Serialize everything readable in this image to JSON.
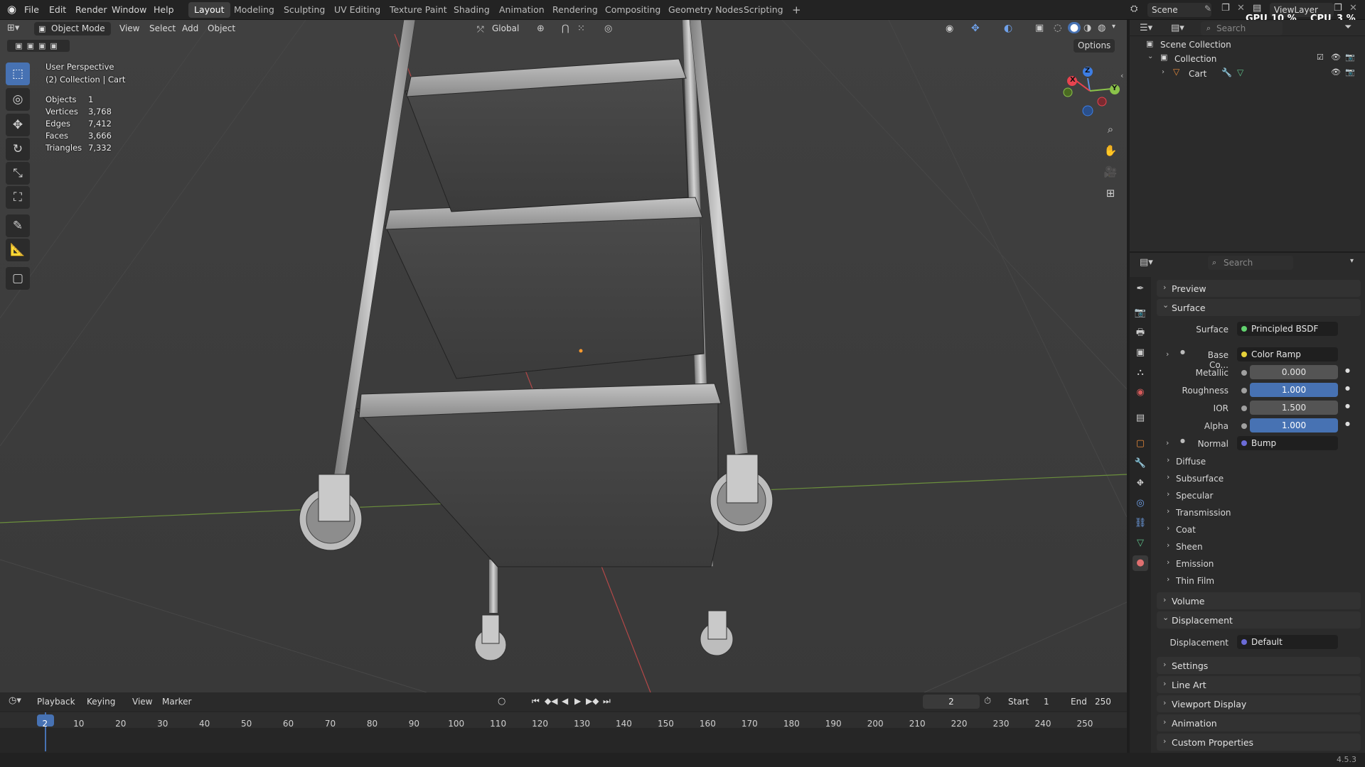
{
  "topbar": {
    "menus": [
      "File",
      "Edit",
      "Render",
      "Window",
      "Help"
    ],
    "workspaces": [
      "Layout",
      "Modeling",
      "Sculpting",
      "UV Editing",
      "Texture Paint",
      "Shading",
      "Animation",
      "Rendering",
      "Compositing",
      "Geometry Nodes",
      "Scripting"
    ],
    "active_workspace": "Layout",
    "add_workspace": "+",
    "scene_label": "Scene",
    "viewlayer_label": "ViewLayer",
    "gpu_label": "GPU",
    "gpu_value": "10 %",
    "cpu_label": "CPU",
    "cpu_value": "3 %"
  },
  "viewport_header": {
    "mode": "Object Mode",
    "menus": [
      "View",
      "Select",
      "Add",
      "Object"
    ],
    "transform_orientation": "Global",
    "options_label": "Options"
  },
  "viewport_overlay": {
    "perspective": "User Perspective",
    "collection_object": "(2) Collection | Cart",
    "stats": [
      {
        "label": "Objects",
        "value": "1"
      },
      {
        "label": "Vertices",
        "value": "3,768"
      },
      {
        "label": "Edges",
        "value": "7,412"
      },
      {
        "label": "Faces",
        "value": "3,666"
      },
      {
        "label": "Triangles",
        "value": "7,332"
      }
    ],
    "gizmo_axes": {
      "x": "X",
      "y": "Y",
      "z": "Z"
    }
  },
  "timeline": {
    "menus": [
      "Playback",
      "Keying",
      "View",
      "Marker"
    ],
    "current_frame": "2",
    "start_label": "Start",
    "start_value": "1",
    "end_label": "End",
    "end_value": "250",
    "ruler": [
      "2",
      "10",
      "20",
      "30",
      "40",
      "50",
      "60",
      "70",
      "80",
      "90",
      "100",
      "110",
      "120",
      "130",
      "140",
      "150",
      "160",
      "170",
      "180",
      "190",
      "200",
      "210",
      "220",
      "230",
      "240",
      "250"
    ]
  },
  "outliner": {
    "search_placeholder": "Search",
    "scene_collection": "Scene Collection",
    "collection": "Collection",
    "object": "Cart"
  },
  "properties": {
    "search_placeholder": "Search",
    "preview": "Preview",
    "surface_section": "Surface",
    "surface_label": "Surface",
    "surface_value": "Principled BSDF",
    "base_color_label": "Base Co...",
    "base_color_value": "Color Ramp",
    "metallic_label": "Metallic",
    "metallic_value": "0.000",
    "roughness_label": "Roughness",
    "roughness_value": "1.000",
    "ior_label": "IOR",
    "ior_value": "1.500",
    "alpha_label": "Alpha",
    "alpha_value": "1.000",
    "normal_label": "Normal",
    "normal_value": "Bump",
    "subpanels": [
      "Diffuse",
      "Subsurface",
      "Specular",
      "Transmission",
      "Coat",
      "Sheen",
      "Emission",
      "Thin Film"
    ],
    "volume": "Volume",
    "displacement_section": "Displacement",
    "displacement_label": "Displacement",
    "displacement_value": "Default",
    "settings": "Settings",
    "line_art": "Line Art",
    "viewport_display": "Viewport Display",
    "animation": "Animation",
    "custom_properties": "Custom Properties"
  },
  "statusbar": {
    "version": "4.5.3"
  },
  "colors": {
    "accent": "#4772b3",
    "x_axis": "#e8434f",
    "y_axis": "#8bc34a",
    "z_axis": "#3d7ee5"
  }
}
